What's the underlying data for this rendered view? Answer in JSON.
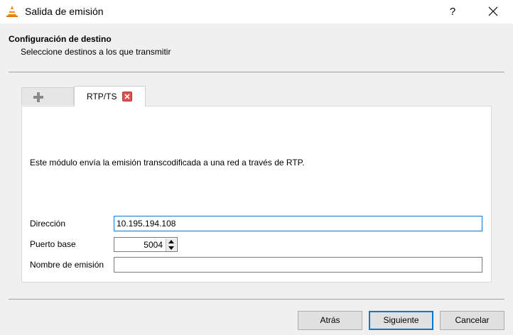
{
  "window": {
    "title": "Salida de emisión",
    "help_label": "?",
    "icon": "vlc-cone-icon"
  },
  "header": {
    "title": "Configuración de destino",
    "subtitle": "Seleccione destinos a los que transmitir"
  },
  "tabs": {
    "add_icon": "plus-icon",
    "active_label": "RTP/TS",
    "close_icon": "close-icon"
  },
  "panel": {
    "description": "Este módulo envía la emisión transcodificada a una red a través de RTP.",
    "address_label": "Dirección",
    "address_value": "10.195.194.108",
    "port_label": "Puerto base",
    "port_value": "5004",
    "stream_name_label": "Nombre de emisión",
    "stream_name_value": ""
  },
  "buttons": {
    "back": "Atrás",
    "next": "Siguiente",
    "cancel": "Cancelar"
  },
  "colors": {
    "accent": "#0078d7",
    "tab_close": "#d9534f"
  }
}
